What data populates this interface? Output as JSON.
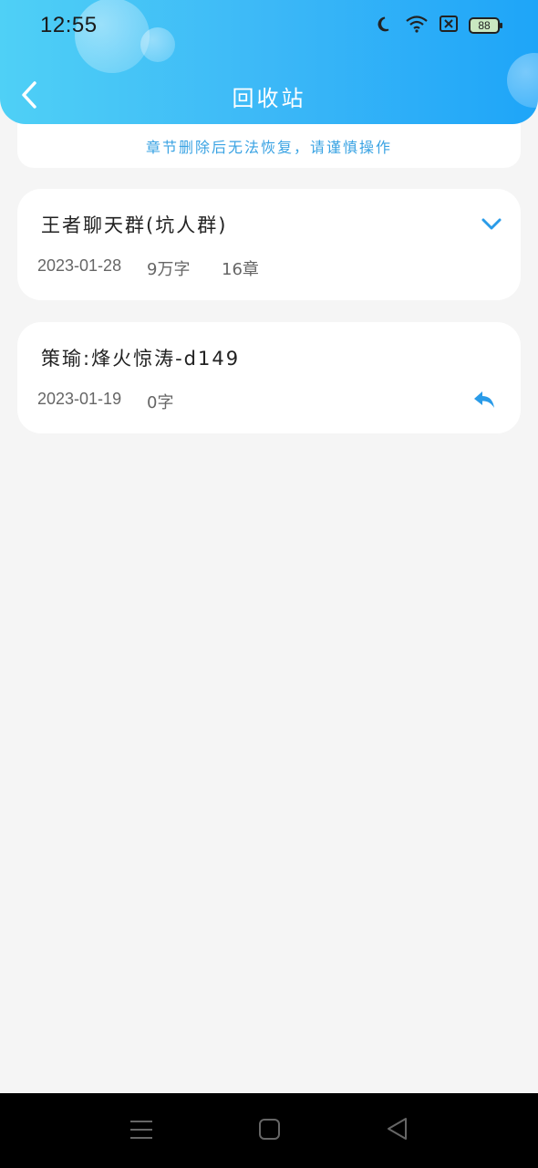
{
  "status_bar": {
    "time": "12:55",
    "battery": "88",
    "icons": [
      "moon-icon",
      "wifi-icon",
      "sim-x-icon",
      "battery-icon"
    ]
  },
  "nav": {
    "title": "回收站",
    "back_icon": "chevron-left-icon"
  },
  "notice": {
    "text": "章节删除后无法恢复，请谨慎操作"
  },
  "items": [
    {
      "title": "王者聊天群(坑人群)",
      "date": "2023-01-28",
      "words": "9万字",
      "chapters": "16章",
      "action_icon": "chevron-down-icon"
    },
    {
      "title": "策瑜:烽火惊涛-d149",
      "date": "2023-01-19",
      "words": "0字",
      "chapters": "",
      "action_icon": "restore-icon"
    }
  ],
  "system_nav": {
    "icons": [
      "menu-icon",
      "home-icon",
      "back-triangle-icon"
    ]
  },
  "colors": {
    "header_start": "#4fd0f6",
    "header_end": "#1ea5f8",
    "accent": "#2a9be8",
    "background": "#f5f5f5"
  }
}
